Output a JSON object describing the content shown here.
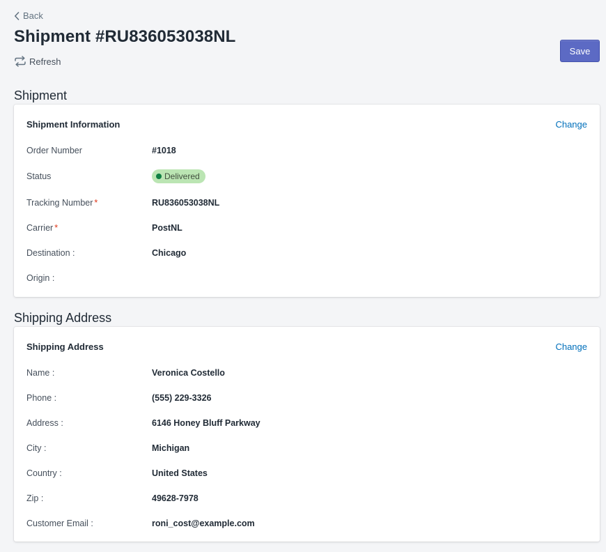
{
  "header": {
    "back_label": "Back",
    "title": "Shipment #RU836053038NL",
    "refresh_label": "Refresh",
    "save_label": "Save"
  },
  "shipment_section": {
    "heading": "Shipment",
    "card_title": "Shipment Information",
    "change_label": "Change",
    "fields": {
      "order_number": {
        "label": "Order Number",
        "value": "#1018"
      },
      "status": {
        "label": "Status",
        "value": "Delivered"
      },
      "tracking_number": {
        "label": "Tracking Number",
        "required_mark": "*",
        "value": "RU836053038NL"
      },
      "carrier": {
        "label": "Carrier",
        "required_mark": "*",
        "value": "PostNL"
      },
      "destination": {
        "label": "Destination :",
        "value": "Chicago"
      },
      "origin": {
        "label": "Origin :",
        "value": ""
      }
    }
  },
  "address_section": {
    "heading": "Shipping Address",
    "card_title": "Shipping Address",
    "change_label": "Change",
    "fields": {
      "name": {
        "label": "Name :",
        "value": "Veronica Costello"
      },
      "phone": {
        "label": "Phone :",
        "value": "(555) 229-3326"
      },
      "address": {
        "label": "Address :",
        "value": "6146 Honey Bluff Parkway"
      },
      "city": {
        "label": "City :",
        "value": "Michigan"
      },
      "country": {
        "label": "Country :",
        "value": "United States"
      },
      "zip": {
        "label": "Zip :",
        "value": "49628-7978"
      },
      "email": {
        "label": "Customer Email :",
        "value": "roni_cost@example.com"
      }
    }
  },
  "colors": {
    "primary_button": "#5c6ac4",
    "link": "#006fbb",
    "badge_bg": "#bbe5b3",
    "badge_dot": "#108043",
    "required": "#de3618"
  }
}
